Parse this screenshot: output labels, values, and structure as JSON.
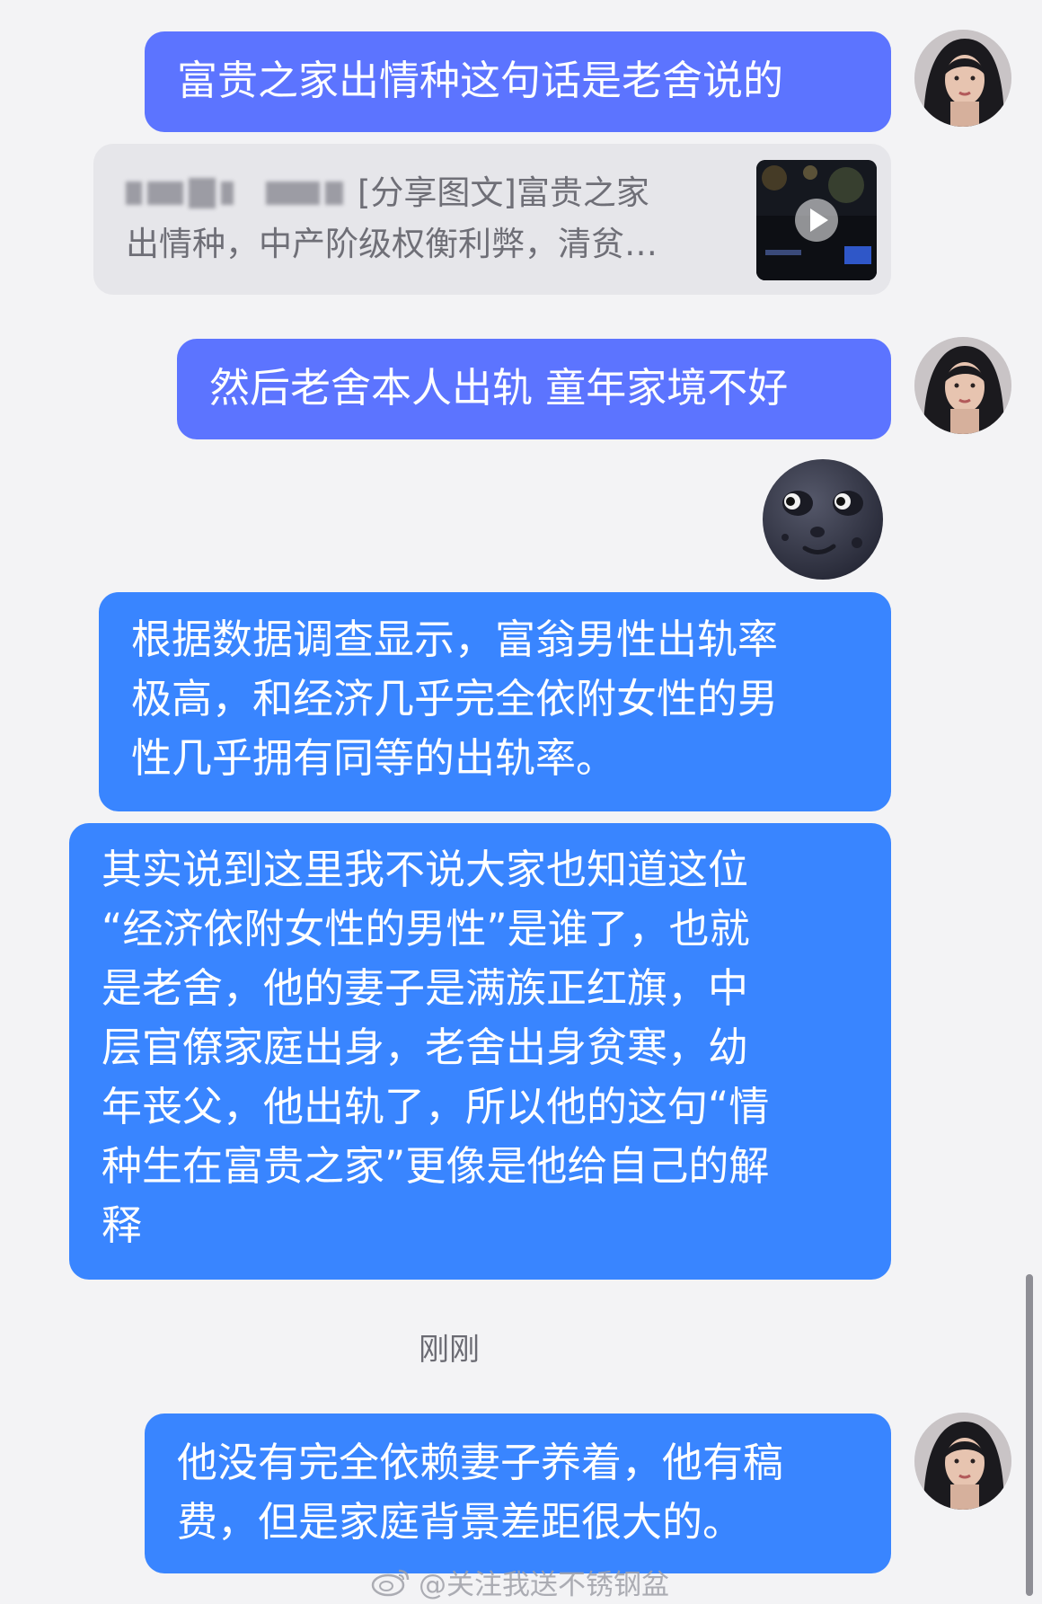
{
  "messages": [
    {
      "text": "富贵之家出情种这句话是老舍说的"
    },
    {
      "share": {
        "sender_blurred": "",
        "line1": "[分享图文]富贵之家",
        "line2": "出情种，中产阶级权衡利弊，清贫…"
      }
    },
    {
      "text": "然后老舍本人出轨 童年家境不好"
    },
    {
      "emoji": "new-moon-face"
    },
    {
      "text": "根据数据调查显示，富翁男性出轨率\n极高，和经济几乎完全依附女性的男\n性几乎拥有同等的出轨率。"
    },
    {
      "text": "其实说到这里我不说大家也知道这位\n“经济依附女性的男性”是谁了，也就\n是老舍，他的妻子是满族正红旗，中\n层官僚家庭出身，老舍出身贫寒，幼\n年丧父，他出轨了，所以他的这句“情\n种生在富贵之家”更像是他给自己的解\n释"
    },
    {
      "timestamp": "刚刚"
    },
    {
      "text": "他没有完全依赖妻子养着，他有稿\n费，但是家庭背景差距很大的。"
    }
  ],
  "watermark": "@关注我送不锈钢盆",
  "colors": {
    "bubble_indigo": "#5c74ff",
    "bubble_blue": "#3985ff",
    "card_bg": "#e6e6ea"
  }
}
